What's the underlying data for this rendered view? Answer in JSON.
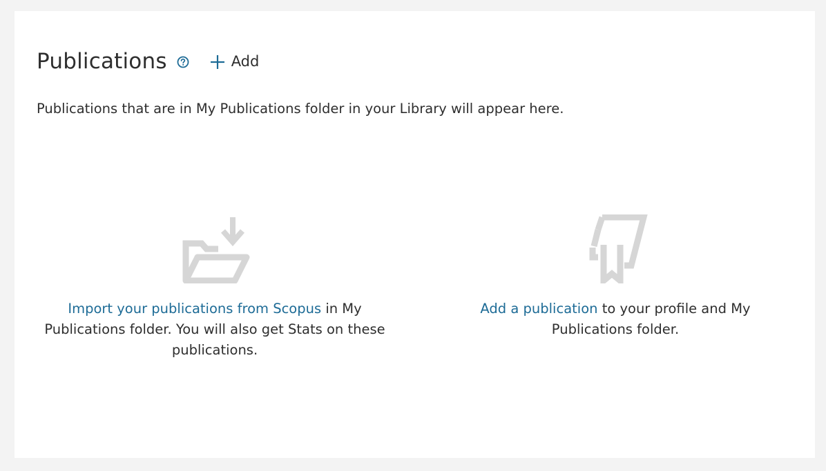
{
  "header": {
    "title": "Publications",
    "help_icon": "help-circle-icon",
    "add_label": "Add",
    "add_icon": "plus-icon"
  },
  "intro_text": "Publications that are in My Publications folder in your Library will appear here.",
  "options": {
    "import": {
      "icon": "folder-import-icon",
      "link_text": "Import your publications from Scopus",
      "rest_text": " in My Publications folder. You will also get Stats on these publications."
    },
    "add": {
      "icon": "certificate-ribbon-icon",
      "link_text": "Add a publication",
      "rest_text": " to your profile and My Publications folder."
    }
  },
  "colors": {
    "link": "#1d6b96",
    "accent": "#1d6b96",
    "icon_gray": "#d6d6d6",
    "background": "#f3f3f3"
  }
}
